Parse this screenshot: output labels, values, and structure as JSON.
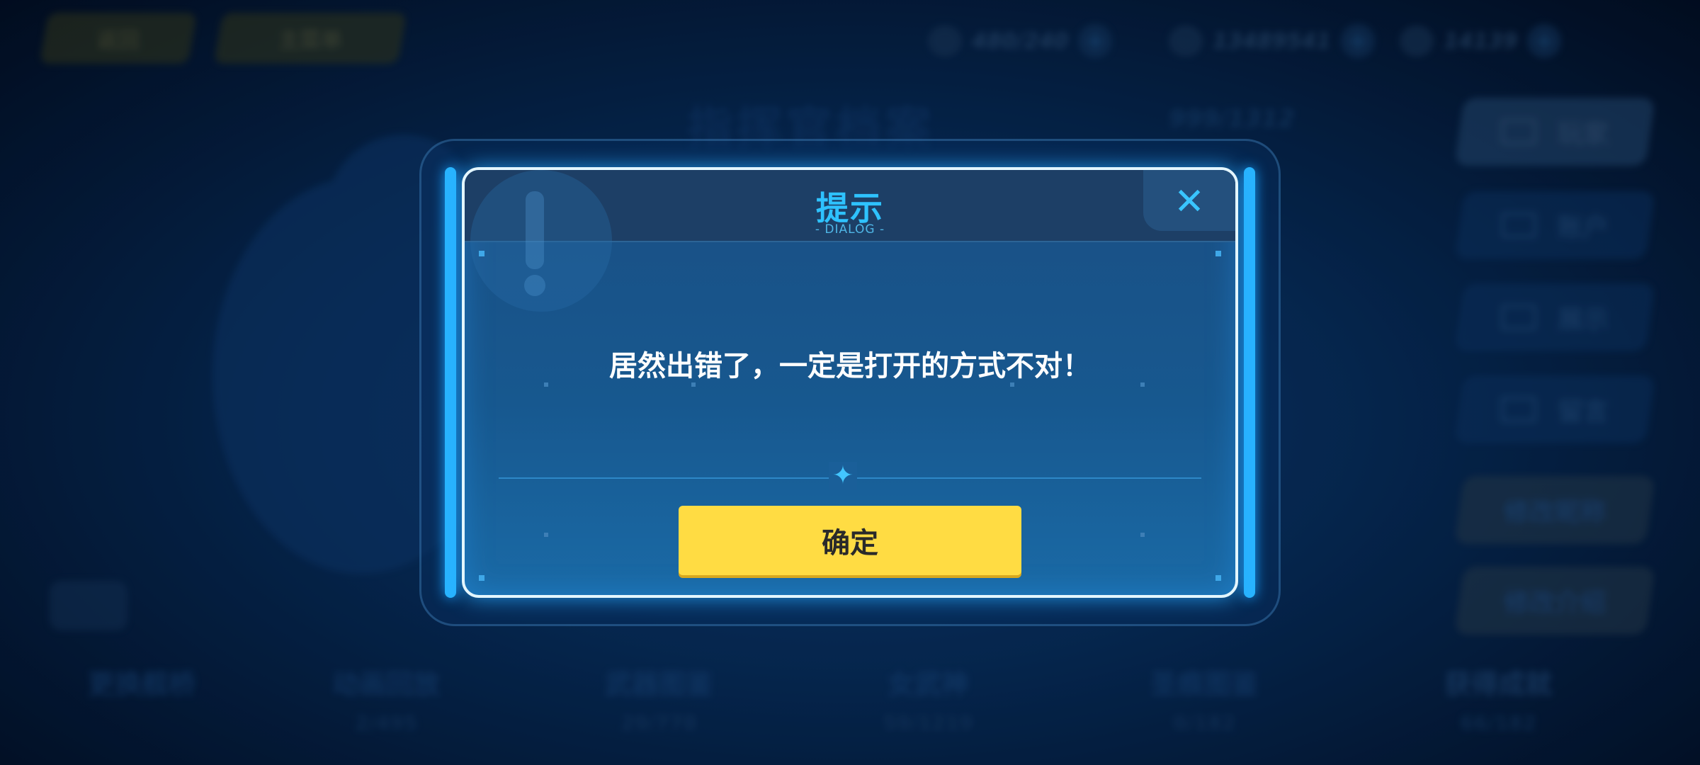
{
  "top_bar": {
    "back_label": "返回",
    "menu_label": "主菜单",
    "resources": [
      {
        "icon": "stamina-icon",
        "value": "480/240"
      },
      {
        "icon": "coin-icon",
        "value": "13489541"
      },
      {
        "icon": "gem-icon",
        "value": "14139"
      }
    ]
  },
  "background": {
    "title": "指挥官档案",
    "count": "999/1312",
    "side_buttons": [
      "玩家",
      "账户",
      "展示",
      "留言",
      "修改昵称",
      "修改介绍"
    ],
    "stats": [
      {
        "label": "更换舰桥",
        "value": ""
      },
      {
        "label": "动画回放",
        "value": "2/495"
      },
      {
        "label": "武器图鉴",
        "value": "29/778"
      },
      {
        "label": "女武神",
        "value": "59/1219"
      },
      {
        "label": "圣痕图鉴",
        "value": "0/182"
      },
      {
        "label": "获得成就",
        "value": "66/182"
      }
    ]
  },
  "dialog": {
    "title": "提示",
    "subtitle": "- DIALOG -",
    "close_symbol": "✕",
    "message": "居然出错了，一定是打开的方式不对！",
    "divider_glyph": "✦",
    "confirm_label": "确定"
  }
}
